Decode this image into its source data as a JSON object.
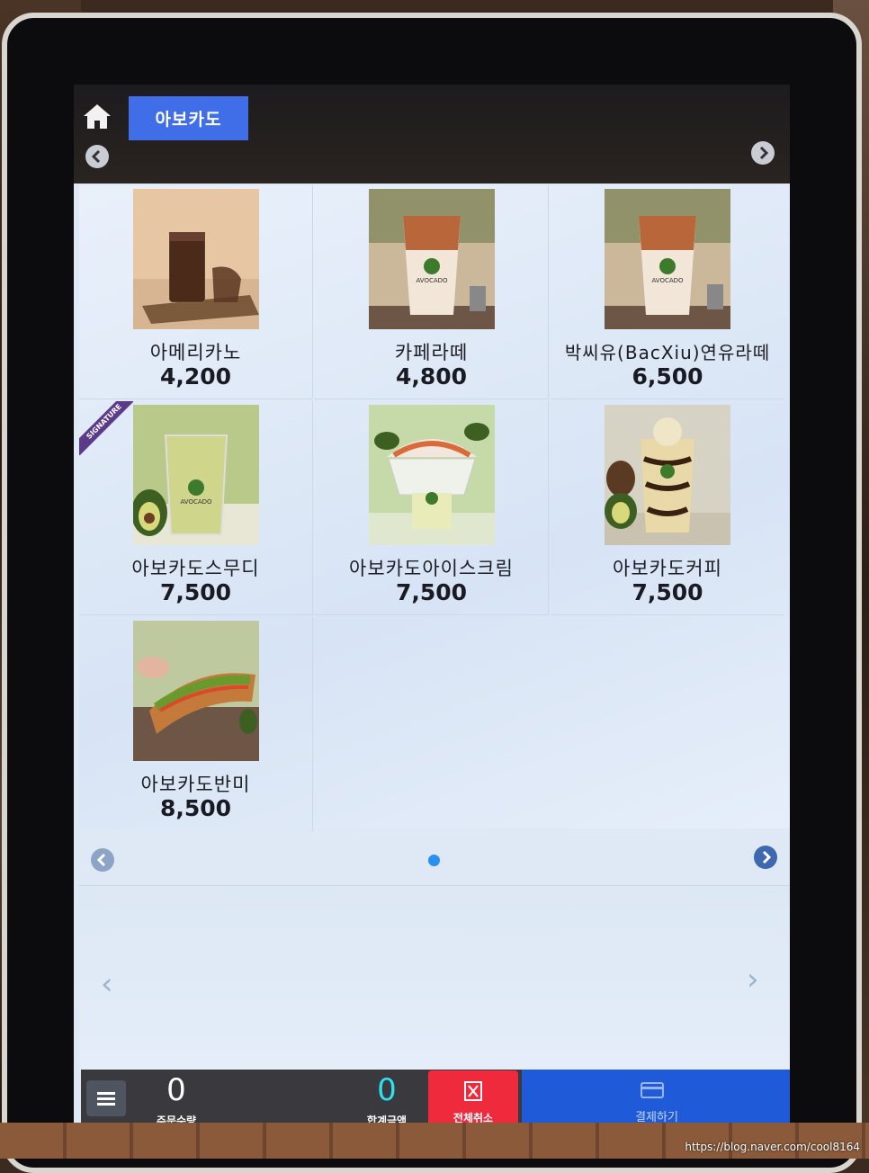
{
  "header": {
    "home_icon": "home-icon",
    "category_tab": "아보카도"
  },
  "menu": {
    "items": [
      {
        "name": "아메리카노",
        "price": "4,200"
      },
      {
        "name": "카페라떼",
        "price": "4,800"
      },
      {
        "name": "박씨유(BacXiu)연유라떼",
        "price": "6,500"
      },
      {
        "name": "아보카도스무디",
        "price": "7,500",
        "badge": "SIGNATURE"
      },
      {
        "name": "아보카도아이스크림",
        "price": "7,500"
      },
      {
        "name": "아보카도커피",
        "price": "7,500"
      },
      {
        "name": "아보카도반미",
        "price": "8,500"
      }
    ]
  },
  "footer": {
    "order_qty_value": "0",
    "order_qty_label": "주문수량",
    "total_value": "0",
    "total_label": "합계금액",
    "cancel_all_label": "전체취소",
    "pay_label": "결제하기"
  },
  "watermark": "https://blog.naver.com/cool8164",
  "colors": {
    "tab_blue": "#3f6ee8",
    "cancel_red": "#ee2a3c",
    "pay_blue": "#1f5bd8",
    "total_cyan": "#2ce0f0",
    "page_dot": "#2b8ff0"
  }
}
